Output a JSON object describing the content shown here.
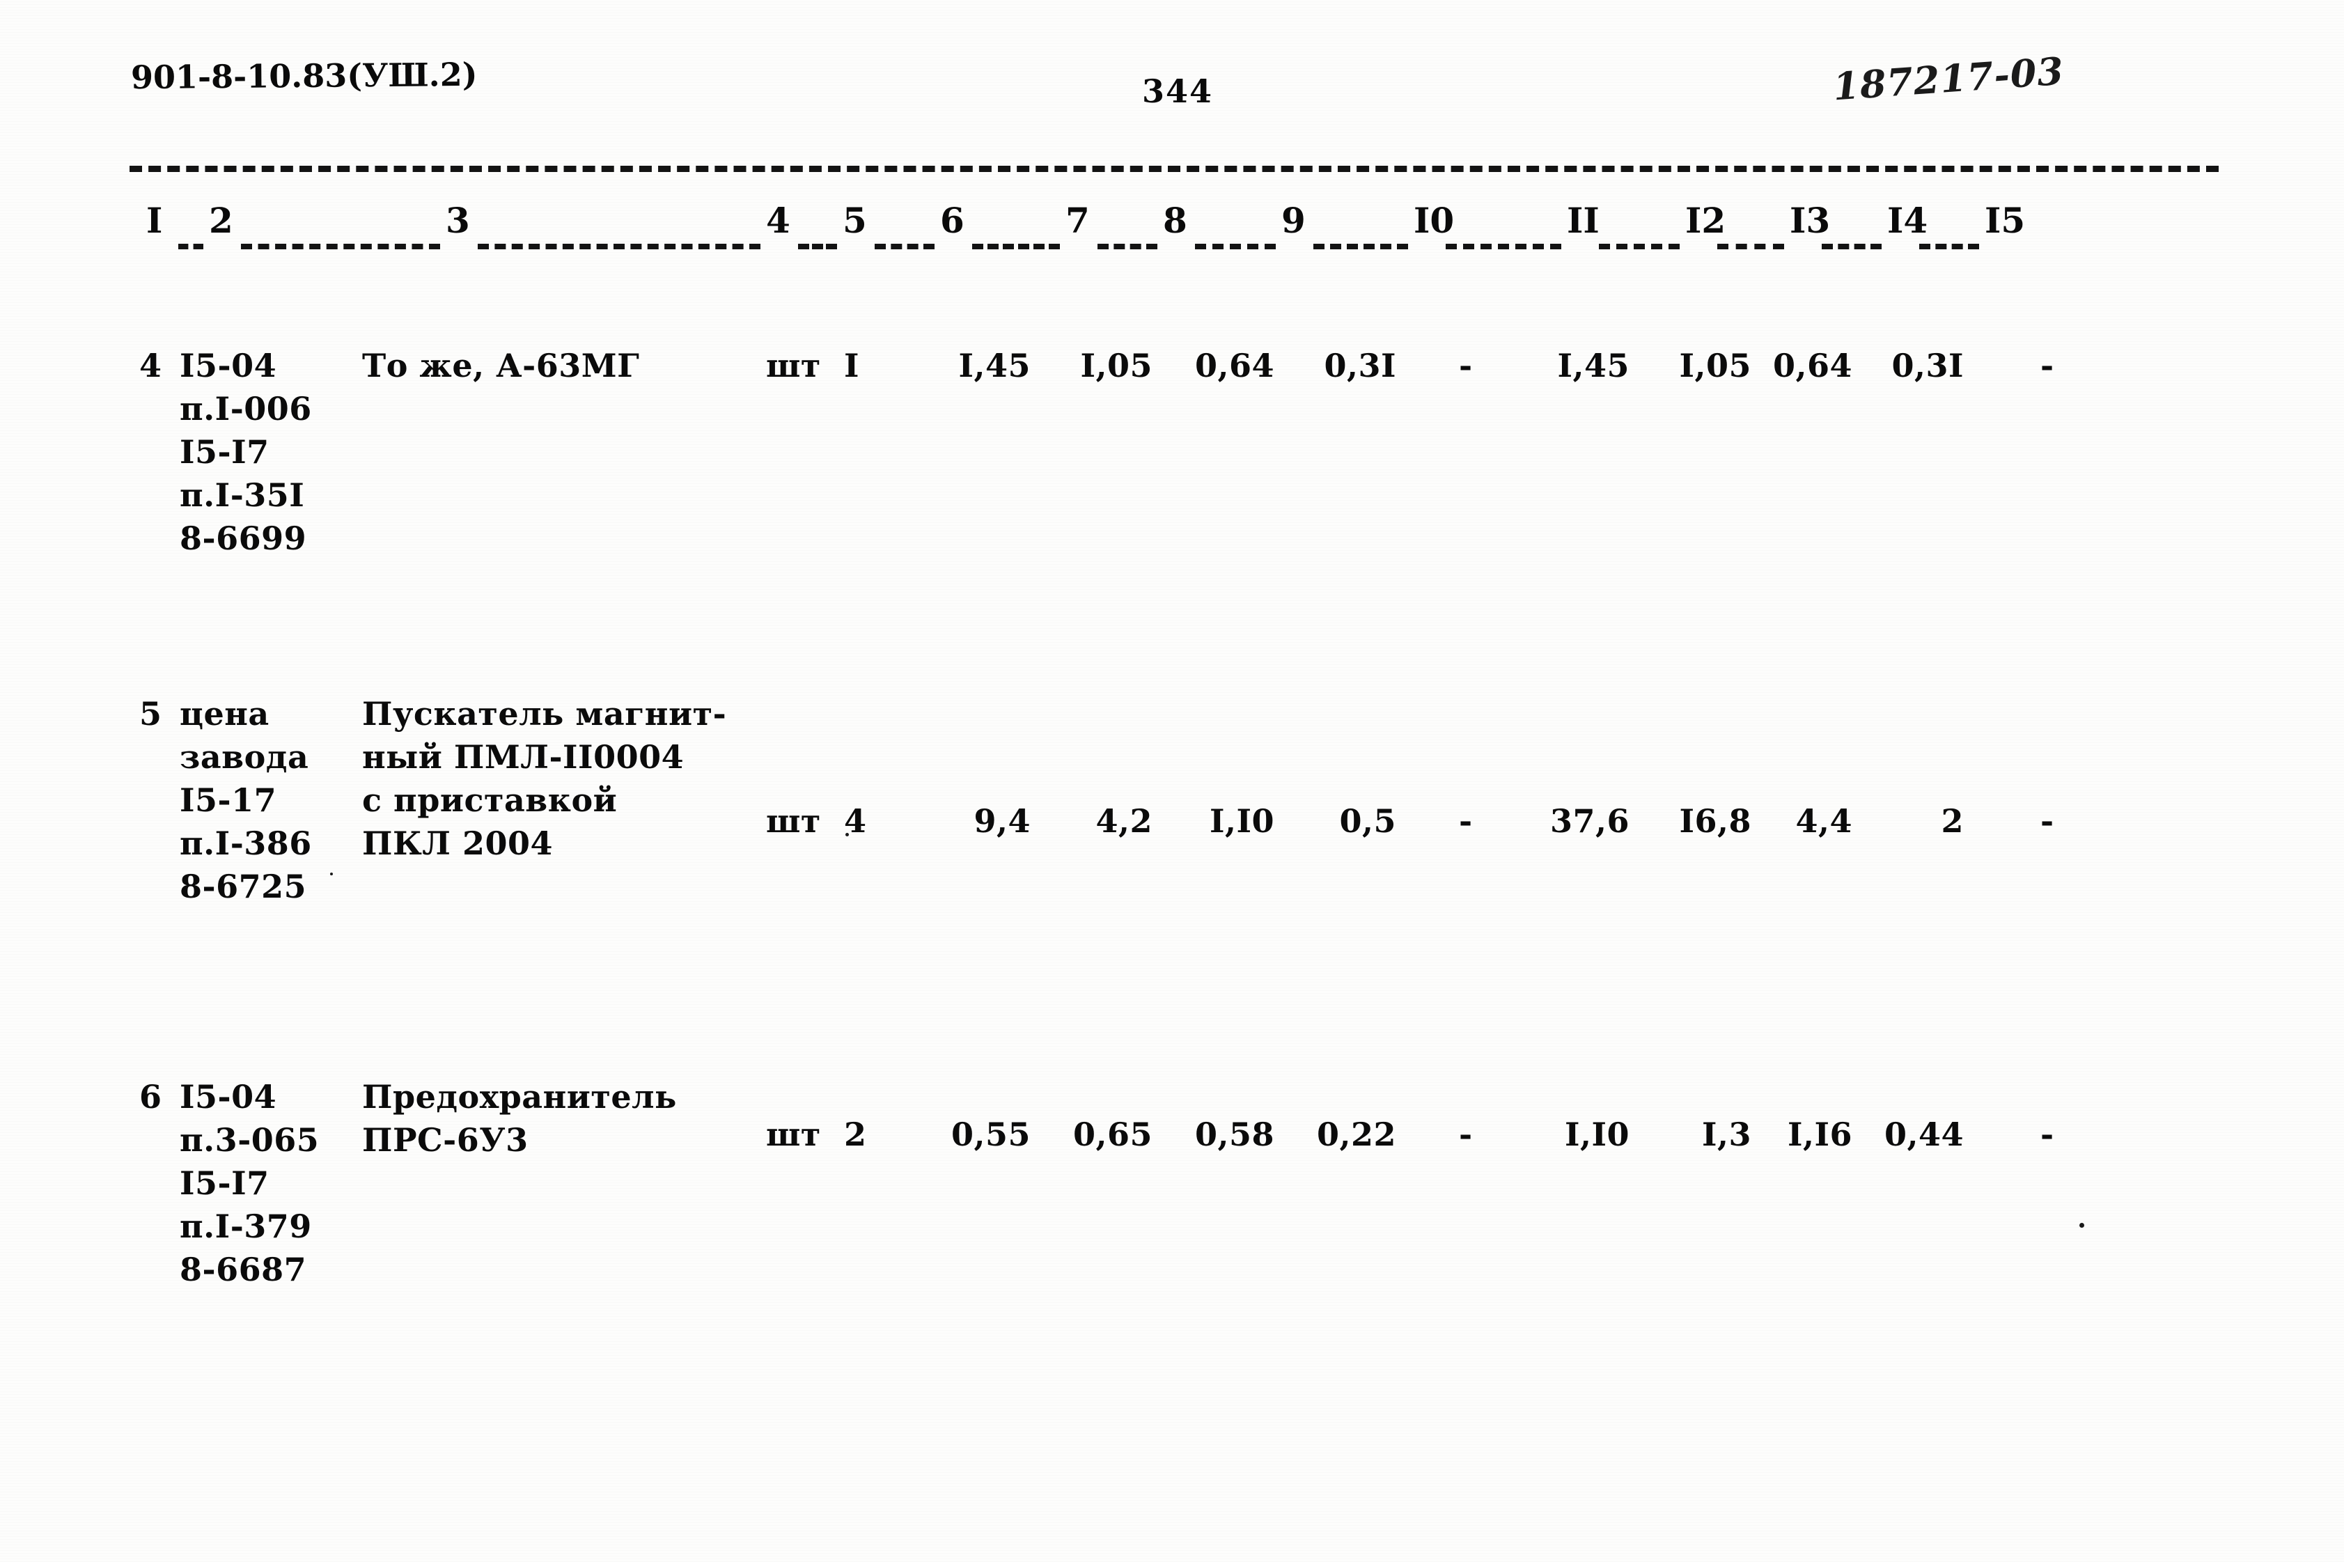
{
  "page": {
    "header_left": "901-8-10.83(УШ.2)",
    "page_number": "344",
    "header_right_handwritten": "187217-03"
  },
  "table": {
    "column_numbers": [
      "I",
      "2",
      "3",
      "4",
      "5",
      "6",
      "7",
      "8",
      "9",
      "I0",
      "II",
      "I2",
      "I3",
      "I4",
      "I5"
    ],
    "rows": [
      {
        "col1": "4",
        "col2_lines": [
          "I5-04",
          "п.I-006",
          "I5-I7",
          "п.I-35I",
          "8-6699"
        ],
        "col3_lines": [
          "То же, А-63МГ"
        ],
        "col4": "шт",
        "col5": "I",
        "col6": "I,45",
        "col7": "I,05",
        "col8": "0,64",
        "col9": "0,3I",
        "col10": "-",
        "col11": "I,45",
        "col12": "I,05",
        "col13": "0,64",
        "col14": "0,3I",
        "col15": "-"
      },
      {
        "col1": "5",
        "col2_lines": [
          "цена",
          "завода",
          "I5-17",
          "п.I-386",
          "8-6725"
        ],
        "col3_lines": [
          "Пускатель магнит-",
          "ный ПМЛ-II0004",
          "с приставкой",
          "ПКЛ 2004"
        ],
        "col4": "шт",
        "col5": "4",
        "col6": "9,4",
        "col7": "4,2",
        "col8": "I,I0",
        "col9": "0,5",
        "col10": "-",
        "col11": "37,6",
        "col12": "I6,8",
        "col13": "4,4",
        "col14": "2",
        "col15": "-"
      },
      {
        "col1": "6",
        "col2_lines": [
          "I5-04",
          "п.3-065",
          "I5-I7",
          "п.I-379",
          "8-6687"
        ],
        "col3_lines": [
          "Предохранитель",
          "ПРС-6У3"
        ],
        "col4": "шт",
        "col5": "2",
        "col6": "0,55",
        "col7": "0,65",
        "col8": "0,58",
        "col9": "0,22",
        "col10": "-",
        "col11": "I,I0",
        "col12": "I,3",
        "col13": "I,I6",
        "col14": "0,44",
        "col15": "-"
      }
    ]
  }
}
